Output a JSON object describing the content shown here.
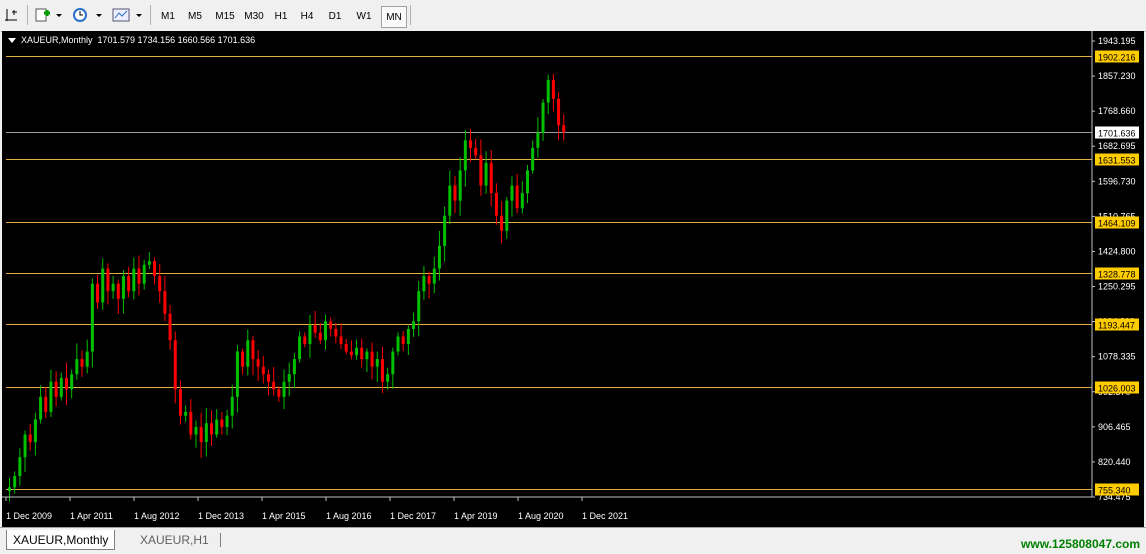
{
  "toolbar": {
    "timeframes": [
      "M1",
      "M5",
      "M15",
      "M30",
      "H1",
      "H4",
      "D1",
      "W1",
      "MN"
    ],
    "active_timeframe": "MN"
  },
  "chart": {
    "header": "XAUEUR,Monthly  1701.579 1734.156 1660.566 1701.636",
    "current_price": "1701.636",
    "colors": {
      "background": "#000000",
      "bull": "#00c000",
      "bear": "#ff0000",
      "level": "#e0b040",
      "grid_text": "#ffffff",
      "label_bg": "#ffcc00"
    }
  },
  "chart_data": {
    "type": "candlestick",
    "symbol": "XAUEUR",
    "timeframe": "Monthly",
    "ohlc_header": {
      "open": 1701.579,
      "high": 1734.156,
      "low": 1660.566,
      "close": 1701.636
    },
    "y_ticks": [
      "1943.195",
      "1857.230",
      "1768.660",
      "1682.695",
      "1596.730",
      "1510.765",
      "1424.800",
      "1250.295",
      "1164.300",
      "1078.335",
      "992.370",
      "906.465",
      "820.440",
      "734.475"
    ],
    "x_ticks": [
      "1 Dec 2009",
      "1 Apr 2011",
      "1 Aug 2012",
      "1 Dec 2013",
      "1 Apr 2015",
      "1 Aug 2016",
      "1 Dec 2017",
      "1 Apr 2019",
      "1 Aug 2020",
      "1 Dec 2021"
    ],
    "ylim": [
      734.475,
      1943.195
    ],
    "levels": [
      "1902.216",
      "1631.553",
      "1464.109",
      "1328.778",
      "1193.447",
      "1026.003",
      "755.340"
    ],
    "closes": [
      760,
      790,
      840,
      900,
      880,
      940,
      1000,
      960,
      1040,
      1000,
      1050,
      1020,
      1060,
      1100,
      1080,
      1120,
      1300,
      1250,
      1340,
      1280,
      1300,
      1260,
      1320,
      1280,
      1340,
      1300,
      1350,
      1360,
      1320,
      1280,
      1220,
      1150,
      1020,
      950,
      960,
      900,
      920,
      880,
      930,
      900,
      940,
      920,
      950,
      1000,
      1120,
      1080,
      1150,
      1100,
      1080,
      1060,
      1040,
      1020,
      1000,
      1040,
      1060,
      1100,
      1160,
      1140,
      1190,
      1170,
      1150,
      1200,
      1180,
      1160,
      1140,
      1120,
      1110,
      1130,
      1100,
      1120,
      1080,
      1100,
      1040,
      1060,
      1120,
      1160,
      1140,
      1180,
      1200,
      1280,
      1320,
      1300,
      1340,
      1400,
      1480,
      1560,
      1520,
      1600,
      1680,
      1660,
      1640,
      1560,
      1620,
      1540,
      1480,
      1440,
      1520,
      1560,
      1500,
      1540,
      1600,
      1660,
      1700,
      1780,
      1840,
      1790,
      1720,
      1701
    ]
  },
  "tabs": [
    {
      "label": "XAUEUR,Monthly",
      "active": true
    },
    {
      "label": "XAUEUR,H1",
      "active": false
    }
  ],
  "watermark": "www.125808047.com"
}
